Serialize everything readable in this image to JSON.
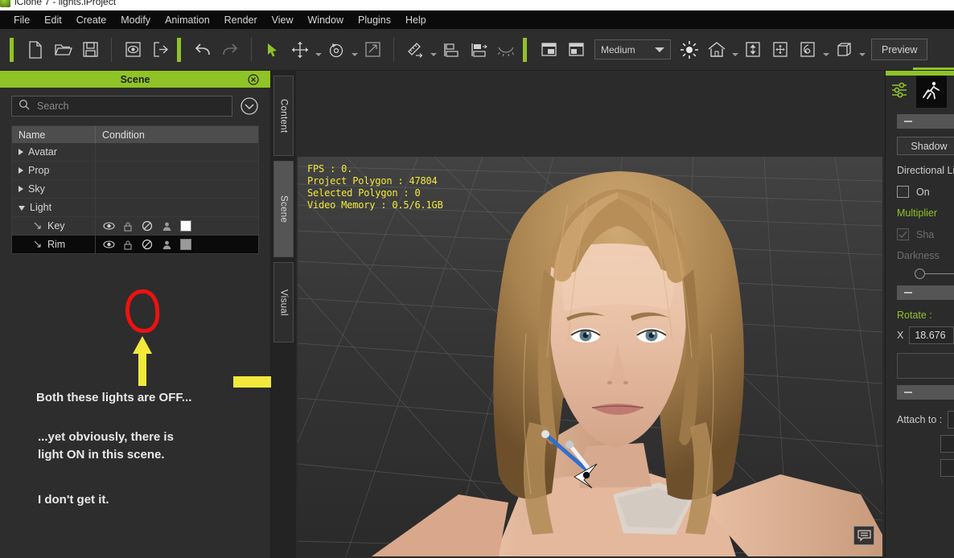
{
  "window": {
    "title": "iClone 7 - lights.iProject",
    "logo_icon": "iclone-logo-icon"
  },
  "menubar": {
    "items": [
      "File",
      "Edit",
      "Create",
      "Modify",
      "Animation",
      "Render",
      "View",
      "Window",
      "Plugins",
      "Help"
    ]
  },
  "toolbar": {
    "quality_select": "Medium",
    "preview_label": "Preview",
    "icons": [
      "new-project-icon",
      "open-project-icon",
      "save-project-icon",
      "preview-render-icon",
      "export-icon",
      "undo-icon",
      "redo-icon",
      "select-cursor-icon",
      "move-icon",
      "rotate-icon",
      "scale-icon",
      "align-icon",
      "align-left-icon",
      "align-right-icon",
      "hide-icon",
      "layout-icon",
      "layout-panel-icon",
      "light-icon",
      "home-icon",
      "height-icon",
      "move-all-icon",
      "physics-icon",
      "cube-icon"
    ]
  },
  "scene_panel": {
    "title": "Scene",
    "close_icon": "close-icon",
    "search": {
      "placeholder": "Search",
      "value": "",
      "icon": "search-icon"
    },
    "expand_icon": "chevron-down-circle-icon",
    "columns": [
      "Name",
      "Condition"
    ],
    "rows": [
      {
        "label": "Avatar",
        "level": 0,
        "expanded": false,
        "selected": false,
        "has_condition": false
      },
      {
        "label": "Prop",
        "level": 0,
        "expanded": false,
        "selected": false,
        "has_condition": false
      },
      {
        "label": "Sky",
        "level": 0,
        "expanded": false,
        "selected": false,
        "has_condition": false
      },
      {
        "label": "Light",
        "level": 0,
        "expanded": true,
        "selected": false,
        "has_condition": false
      },
      {
        "label": "Key",
        "level": 1,
        "expanded": false,
        "selected": false,
        "has_condition": true,
        "swatch": "#ffffff"
      },
      {
        "label": "Rim",
        "level": 1,
        "expanded": false,
        "selected": true,
        "has_condition": true,
        "swatch": "#9a9a9a"
      }
    ],
    "condition_icons": [
      "eye-icon",
      "lock-icon",
      "prohibited-icon",
      "person-icon"
    ]
  },
  "annotations": {
    "circle_color": "#ee1111",
    "arrow_color": "#f2e93c",
    "text1": "Both these lights are OFF...",
    "text2": "...yet obviously, there is\nlight ON in this scene.",
    "text3": "I don't get it."
  },
  "vertical_tabs": {
    "items": [
      "Content",
      "Scene",
      "Visual"
    ],
    "active": "Scene"
  },
  "viewport": {
    "stats": "FPS : 0.\nProject Polygon : 47804\nSelected Polygon : 0\nVideo Memory : 0.5/6.1GB",
    "stats_color": "#f2e93c",
    "comment_icon": "comment-icon",
    "gizmo": "light-direction-gizmo"
  },
  "right_panel": {
    "tabs": [
      "sliders-icon",
      "motion-icon"
    ],
    "active_tab": 1,
    "shadow_button": "Shadow",
    "directional_light_label": "Directional Li",
    "on_label": "On",
    "multiplier_label": "Multiplier",
    "shadow_check_label": "Sha",
    "darkness_label": "Darkness",
    "rotate_label": "Rotate :",
    "rotate_x_axis": "X",
    "rotate_x_value": "18.676",
    "attach_label": "Attach to :",
    "accent_color": "#8fc326"
  }
}
